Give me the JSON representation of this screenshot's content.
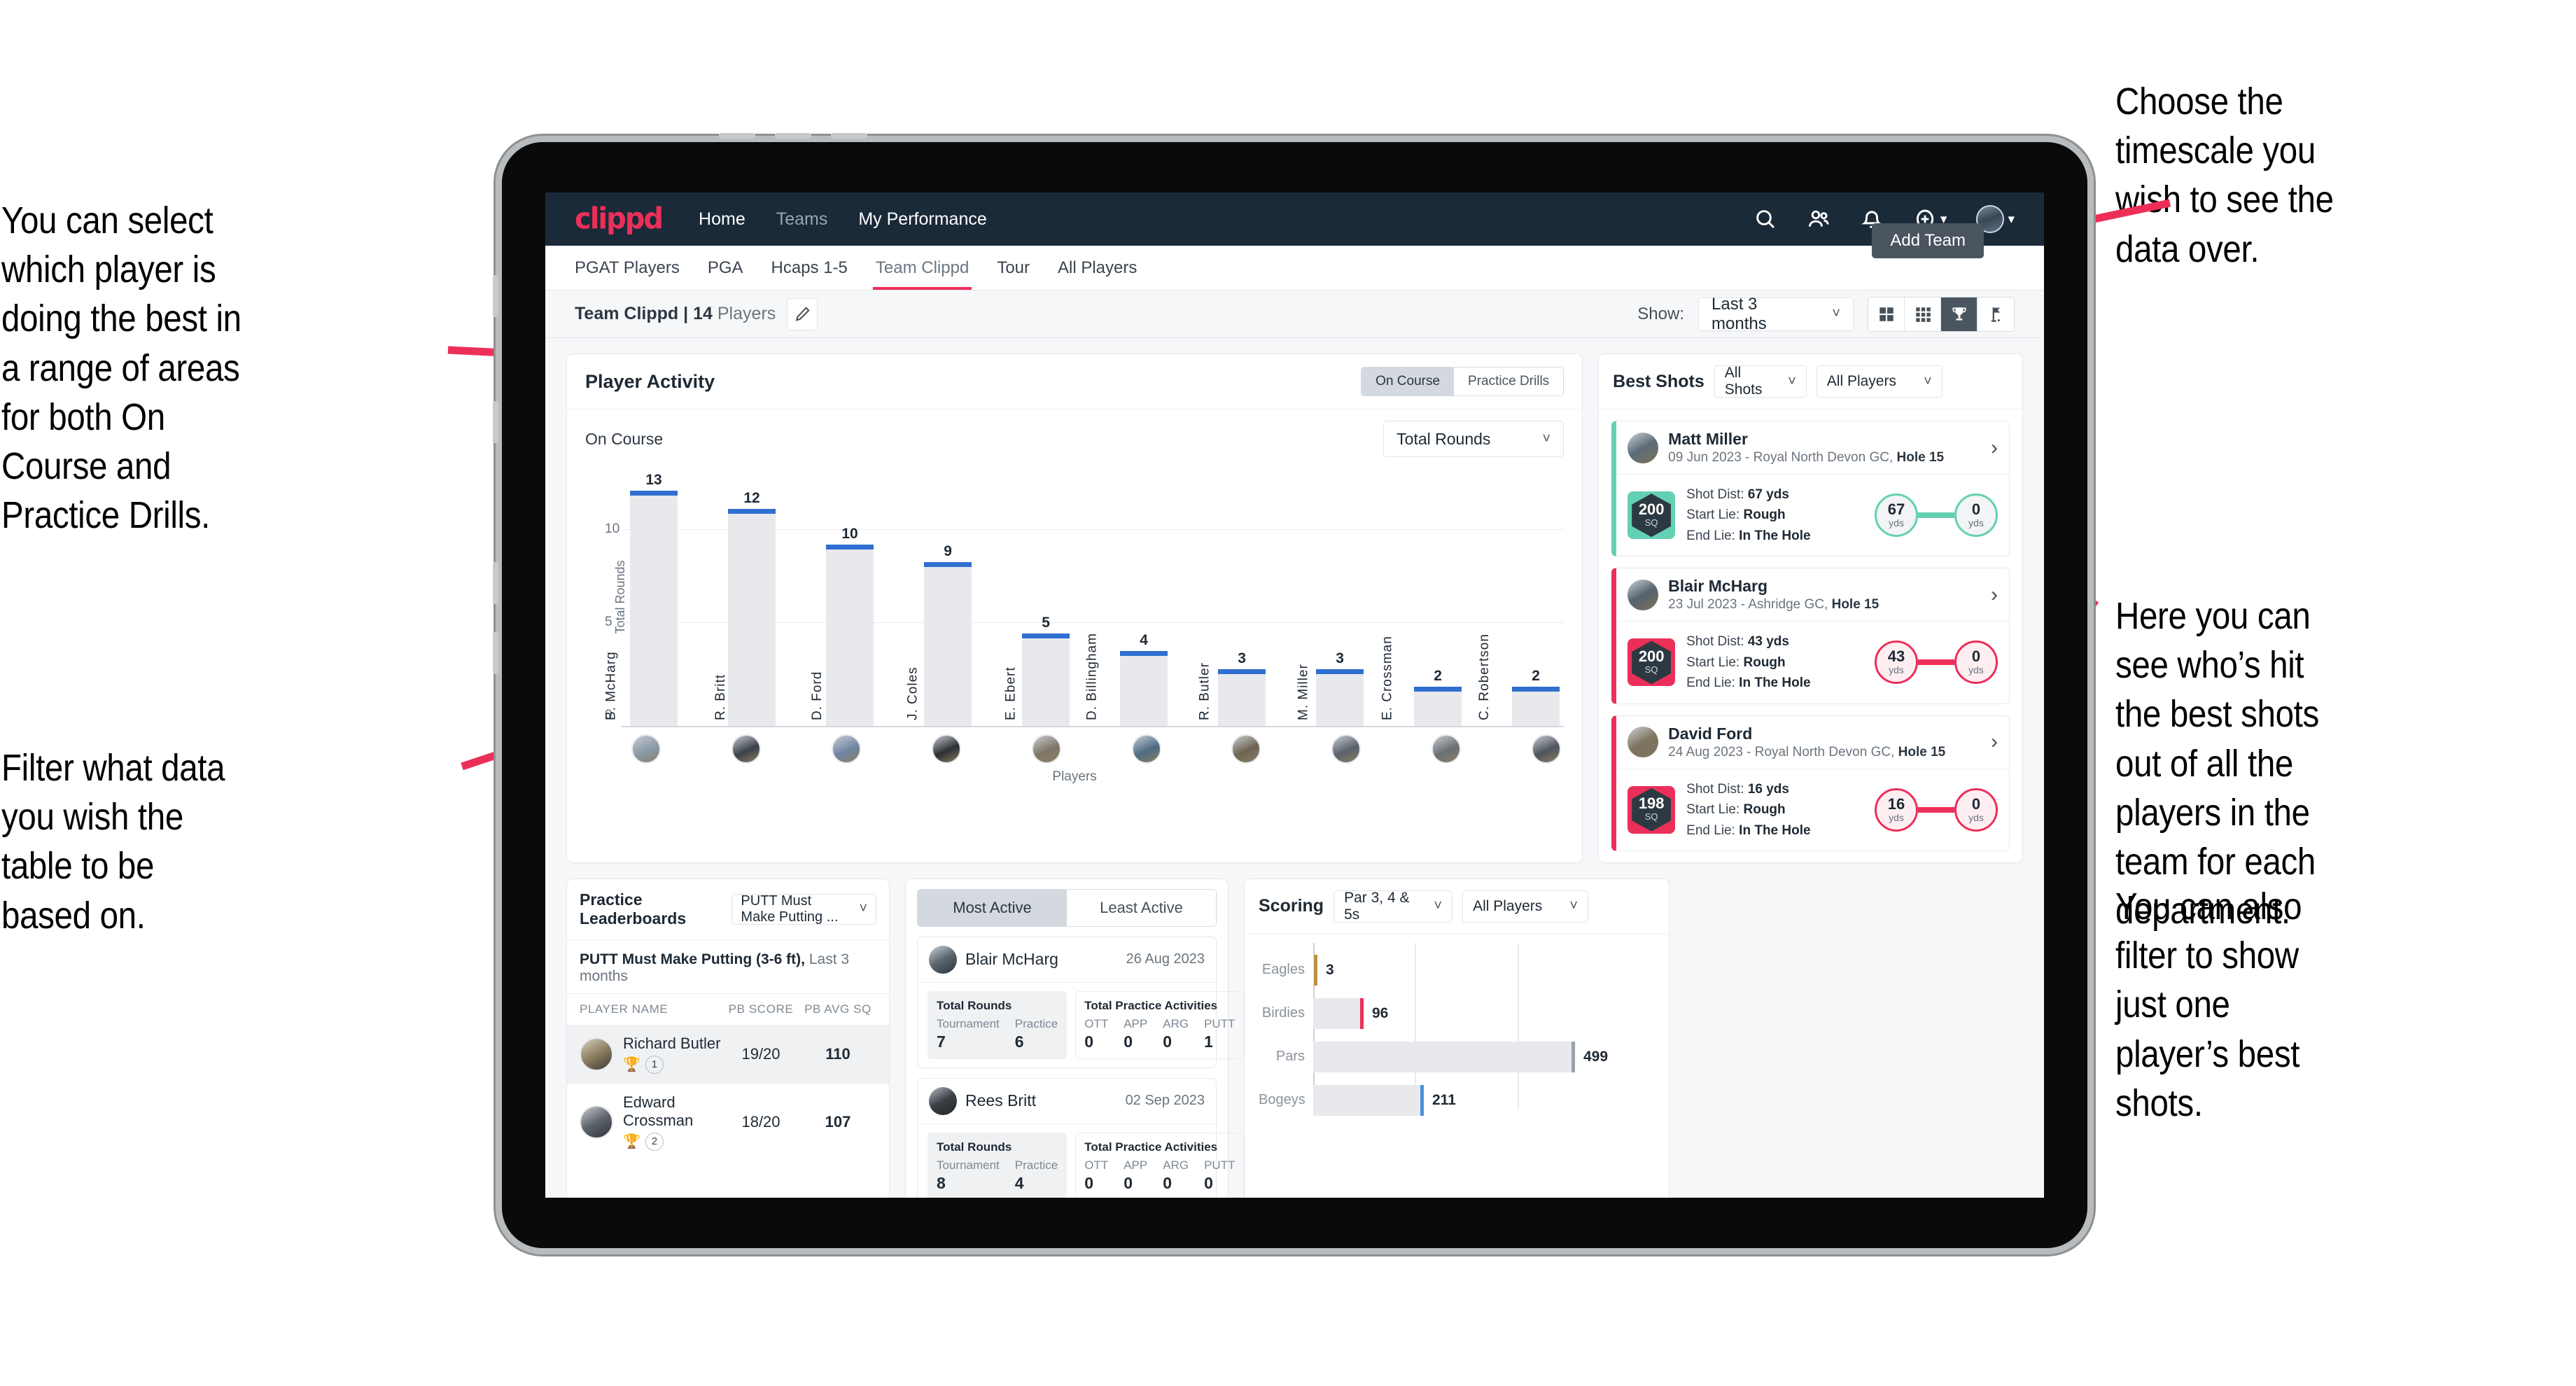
{
  "annotations": {
    "left_top": "You can select which player is doing the best in a range of areas for both On Course and Practice Drills.",
    "left_bottom": "Filter what data you wish the table to be based on.",
    "right_top": "Choose the timescale you wish to see the data over.",
    "right_mid": "Here you can see who’s hit the best shots out of all the players in the team for each department.",
    "right_bottom": "You can also filter to show just one player’s best shots."
  },
  "colors": {
    "brand": "#ec2f59",
    "navy": "#1b2a38",
    "teal": "#63d0b3",
    "blue": "#2f6fd0",
    "gold": "#b99341"
  },
  "topnav": {
    "logo": "clippd",
    "links": [
      {
        "label": "Home",
        "active": true
      },
      {
        "label": "Teams",
        "active": false
      },
      {
        "label": "My Performance",
        "active": true
      }
    ],
    "icons": [
      "search-icon",
      "people-icon",
      "bell-icon",
      "plus-circle-icon"
    ]
  },
  "tabbar": {
    "tabs": [
      {
        "label": "PGAT Players",
        "active": false
      },
      {
        "label": "PGA",
        "active": false
      },
      {
        "label": "Hcaps 1-5",
        "active": false
      },
      {
        "label": "Team Clippd",
        "active": true
      },
      {
        "label": "Tour",
        "active": false
      },
      {
        "label": "All Players",
        "active": false
      }
    ],
    "add_team": "Add Team"
  },
  "subheader": {
    "team_name": "Team Clippd",
    "separator": "|",
    "player_count": "14",
    "players_word": "Players",
    "show_label": "Show:",
    "timescale": "Last 3 months",
    "view_buttons": [
      "grid-large-icon",
      "grid-small-icon",
      "trophy-icon",
      "flag-icon"
    ],
    "active_view": 2
  },
  "player_activity": {
    "title": "Player Activity",
    "segments": [
      {
        "label": "On Course",
        "active": true
      },
      {
        "label": "Practice Drills",
        "active": false
      }
    ],
    "sub_label": "On Course",
    "metric": "Total Rounds",
    "x_caption": "Players"
  },
  "chart_data": {
    "type": "bar",
    "title": "Player Activity",
    "xlabel": "Players",
    "ylabel": "Total Rounds",
    "ylim": [
      0,
      14
    ],
    "yticks": [
      0,
      5,
      10
    ],
    "grid": true,
    "categories": [
      "B. McHarg",
      "R. Britt",
      "D. Ford",
      "J. Coles",
      "E. Ebert",
      "D. Billingham",
      "R. Butler",
      "M. Miller",
      "E. Crossman",
      "C. Robertson"
    ],
    "values": [
      13,
      12,
      10,
      9,
      5,
      4,
      3,
      3,
      2,
      2
    ],
    "bar_color": "#e8e9ed",
    "cap_color": "#2f6fd0"
  },
  "best_shots": {
    "title": "Best Shots",
    "filter_shots": "All Shots",
    "filter_players": "All Players",
    "cards": [
      {
        "name": "Matt Miller",
        "meta_date": "09 Jun 2023",
        "meta_course": "Royal North Devon GC,",
        "meta_hole": "Hole 15",
        "sq": "200",
        "sq_unit": "SQ",
        "accent": "#63d0b3",
        "shot_dist_label": "Shot Dist:",
        "shot_dist": "67 yds",
        "start_lie_label": "Start Lie:",
        "start_lie": "Rough",
        "end_lie_label": "End Lie:",
        "end_lie": "In The Hole",
        "from_val": "67",
        "from_unit": "yds",
        "to_val": "0",
        "to_unit": "yds"
      },
      {
        "name": "Blair McHarg",
        "meta_date": "23 Jul 2023",
        "meta_course": "Ashridge GC,",
        "meta_hole": "Hole 15",
        "sq": "200",
        "sq_unit": "SQ",
        "accent": "#ec2f59",
        "shot_dist_label": "Shot Dist:",
        "shot_dist": "43 yds",
        "start_lie_label": "Start Lie:",
        "start_lie": "Rough",
        "end_lie_label": "End Lie:",
        "end_lie": "In The Hole",
        "from_val": "43",
        "from_unit": "yds",
        "to_val": "0",
        "to_unit": "yds"
      },
      {
        "name": "David Ford",
        "meta_date": "24 Aug 2023",
        "meta_course": "Royal North Devon GC,",
        "meta_hole": "Hole 15",
        "sq": "198",
        "sq_unit": "SQ",
        "accent": "#ec2f59",
        "shot_dist_label": "Shot Dist:",
        "shot_dist": "16 yds",
        "start_lie_label": "Start Lie:",
        "start_lie": "Rough",
        "end_lie_label": "End Lie:",
        "end_lie": "In The Hole",
        "from_val": "16",
        "from_unit": "yds",
        "to_val": "0",
        "to_unit": "yds"
      }
    ]
  },
  "practice_leaderboards": {
    "title": "Practice Leaderboards",
    "selected_drill": "PUTT Must Make Putting ...",
    "sub_title": "PUTT Must Make Putting (3-6 ft),",
    "sub_period": "Last 3 months",
    "columns": [
      "PLAYER NAME",
      "PB SCORE",
      "PB AVG SQ"
    ],
    "rows": [
      {
        "name": "Richard Butler",
        "rank": "1",
        "pb_score": "19/20",
        "pb_avg_sq": "110",
        "trophy": "gold"
      },
      {
        "name": "Edward Crossman",
        "rank": "2",
        "pb_score": "18/20",
        "pb_avg_sq": "107",
        "trophy": "silver"
      }
    ]
  },
  "activity": {
    "tabs": [
      {
        "label": "Most Active",
        "active": true
      },
      {
        "label": "Least Active",
        "active": false
      }
    ],
    "cards": [
      {
        "name": "Blair McHarg",
        "date": "26 Aug 2023",
        "rounds_title": "Total Rounds",
        "rounds_labels": [
          "Tournament",
          "Practice"
        ],
        "rounds_values": [
          "7",
          "6"
        ],
        "practice_title": "Total Practice Activities",
        "practice_labels": [
          "OTT",
          "APP",
          "ARG",
          "PUTT"
        ],
        "practice_values": [
          "0",
          "0",
          "0",
          "1"
        ]
      },
      {
        "name": "Rees Britt",
        "date": "02 Sep 2023",
        "rounds_title": "Total Rounds",
        "rounds_labels": [
          "Tournament",
          "Practice"
        ],
        "rounds_values": [
          "8",
          "4"
        ],
        "practice_title": "Total Practice Activities",
        "practice_labels": [
          "OTT",
          "APP",
          "ARG",
          "PUTT"
        ],
        "practice_values": [
          "0",
          "0",
          "0",
          "0"
        ]
      }
    ]
  },
  "scoring": {
    "title": "Scoring",
    "filter_par": "Par 3, 4 & 5s",
    "filter_players": "All Players",
    "chart": {
      "type": "bar",
      "orientation": "horizontal",
      "categories": [
        "Eagles",
        "Birdies",
        "Pars",
        "Bogeys"
      ],
      "values": [
        3,
        96,
        499,
        211
      ],
      "xmax": 560,
      "colors": [
        "#b99341",
        "#ec2f59",
        "#9aa3ab",
        "#4a90d9"
      ]
    }
  }
}
